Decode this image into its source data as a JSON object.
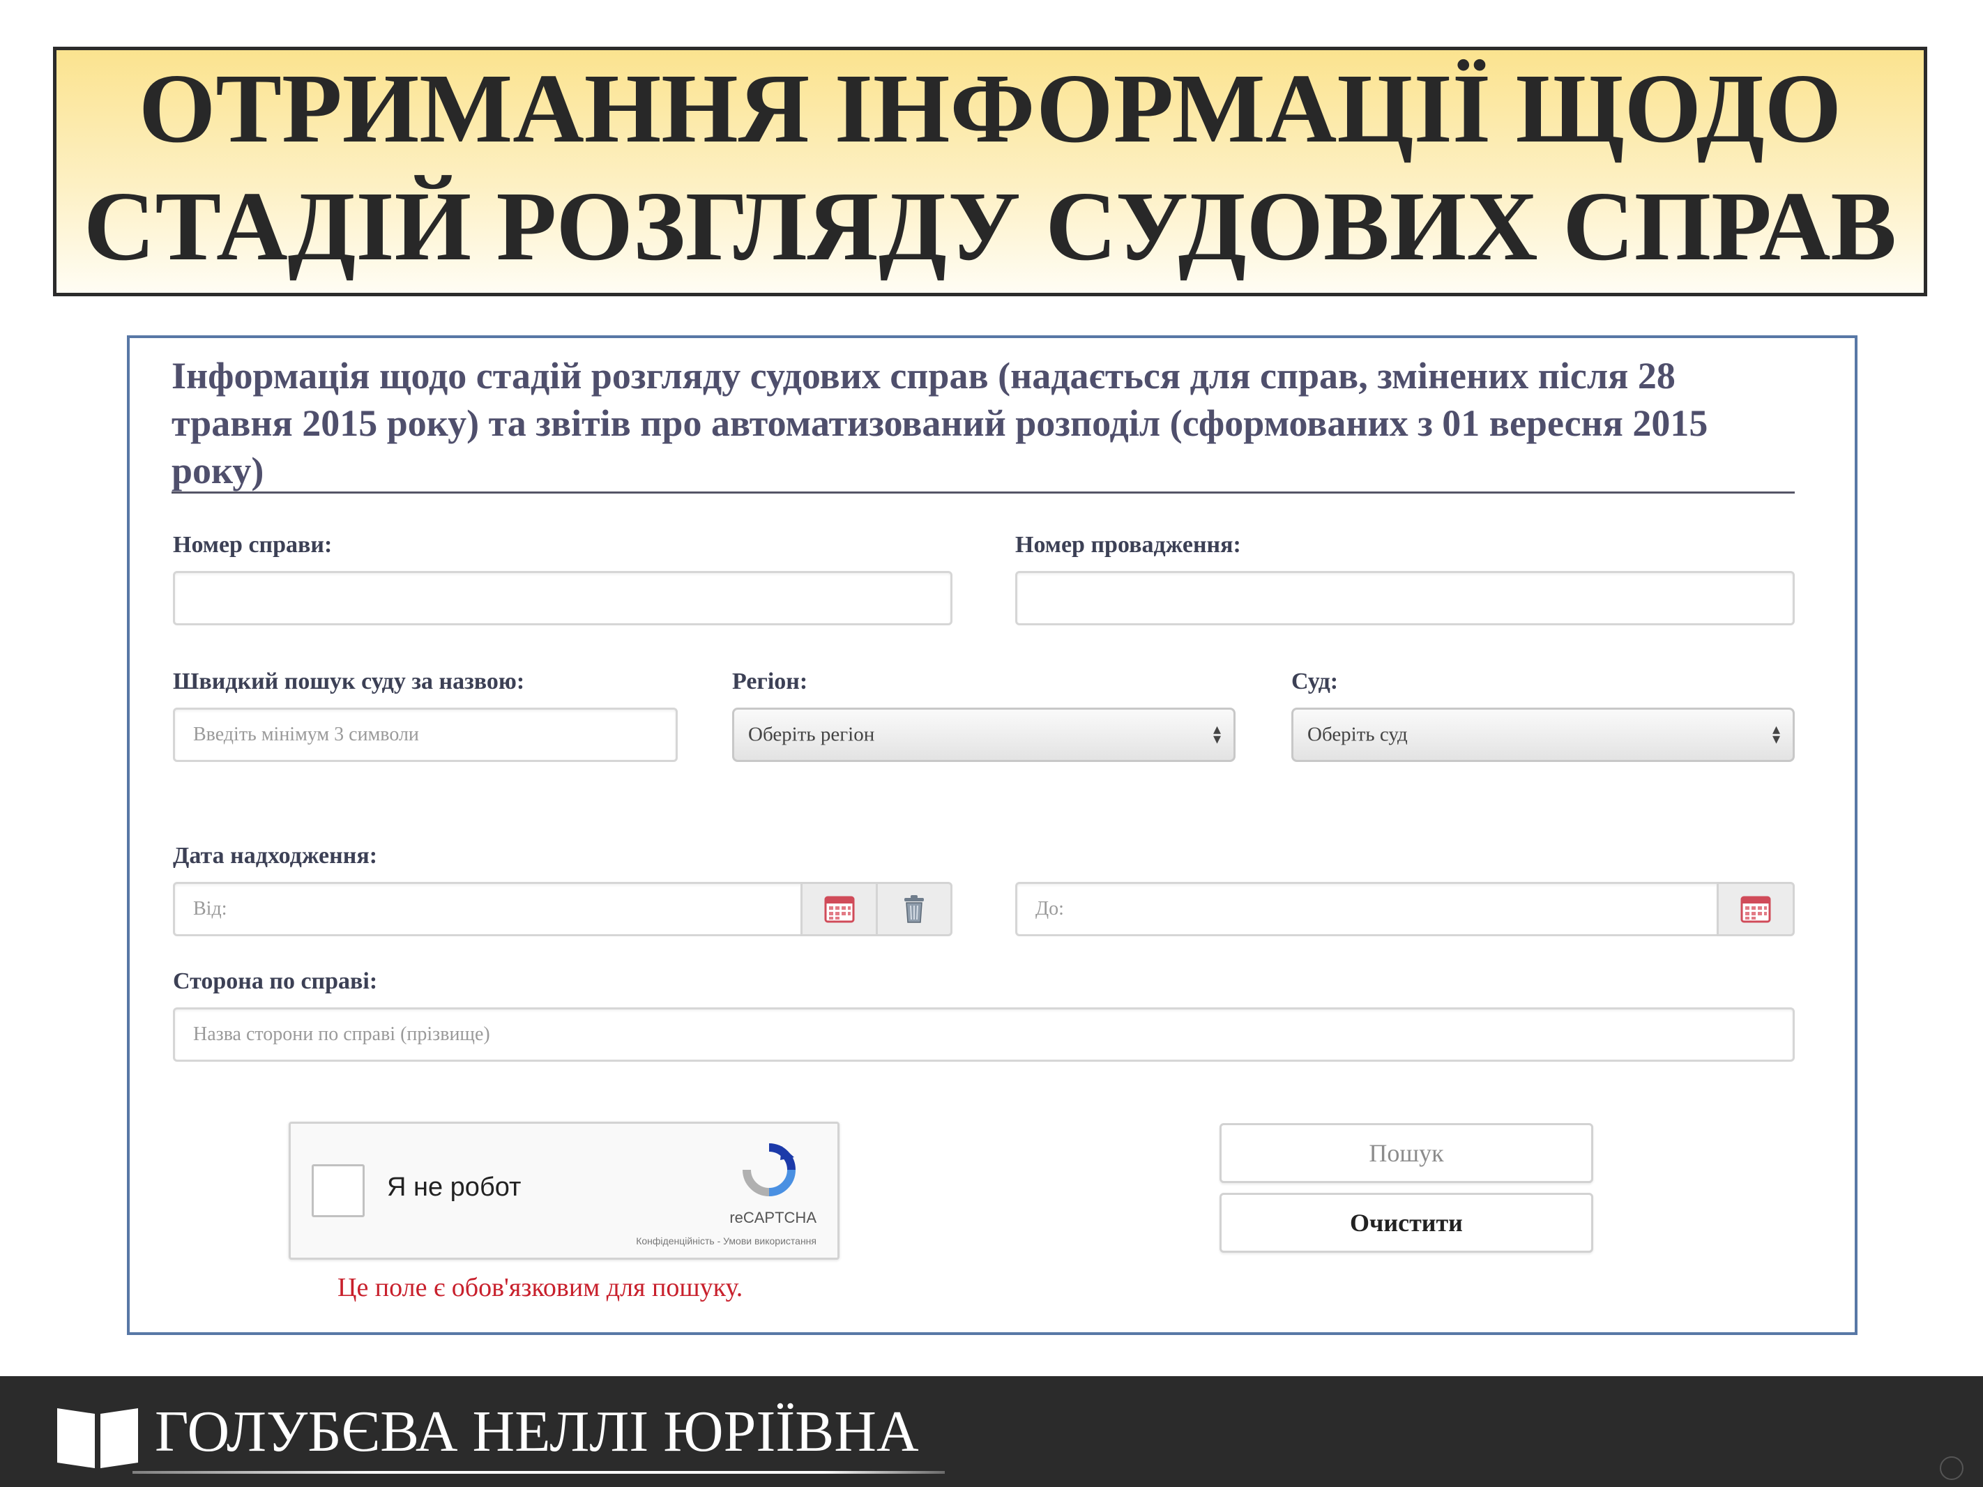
{
  "banner": {
    "title_line1": "ОТРИМАННЯ ІНФОРМАЦІЇ ЩОДО",
    "title_line2": "СТАДІЙ РОЗГЛЯДУ СУДОВИХ СПРАВ"
  },
  "form": {
    "heading": "Інформація щодо стадій розгляду судових справ (надається для справ, змінених після 28 травня 2015 року) та звітів про автоматизований розподіл (сформованих з 01 вересня 2015 року)",
    "case_number": {
      "label": "Номер справи:",
      "value": ""
    },
    "proceeding_number": {
      "label": "Номер провадження:",
      "value": ""
    },
    "court_quick_search": {
      "label": "Швидкий пошук суду за назвою:",
      "placeholder": "Введіть мінімум 3 символи"
    },
    "region": {
      "label": "Регіон:",
      "selected": "Оберіть регіон"
    },
    "court": {
      "label": "Суд:",
      "selected": "Оберіть суд"
    },
    "receipt_date": {
      "label": "Дата надходження:",
      "from_placeholder": "Від:",
      "to_placeholder": "До:"
    },
    "party": {
      "label": "Сторона по справі:",
      "placeholder": "Назва сторони по справі (прізвище)"
    },
    "captcha": {
      "label": "Я не робот",
      "brand": "reCAPTCHA",
      "terms": "Конфіденційність - Умови використання"
    },
    "required_message": "Це поле є обов'язковим для пошуку.",
    "buttons": {
      "search": "Пошук",
      "clear": "Очистити"
    }
  },
  "footer": {
    "author_name": "ГОЛУБЄВА НЕЛЛІ ЮРІЇВНА"
  },
  "icons": {
    "calendar": "calendar-icon",
    "trash": "trash-icon",
    "select_arrows": "select-arrows-icon",
    "recaptcha_logo": "recaptcha-logo-icon",
    "book_logo": "book-icon"
  },
  "colors": {
    "banner_gold": "#fbe38f",
    "panel_border": "#5878a6",
    "required_red": "#c8202c",
    "footer_bg": "#2b2b2b"
  }
}
